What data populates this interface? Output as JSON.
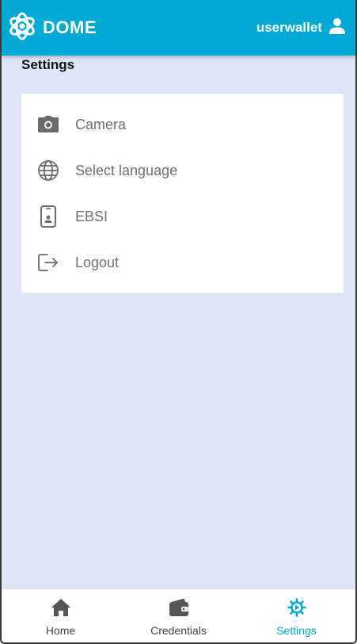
{
  "header": {
    "brand": "DOME",
    "username": "userwallet",
    "background": "#00a9d4"
  },
  "page": {
    "title": "Settings"
  },
  "settings_menu": [
    {
      "label": "Camera",
      "icon": "camera-icon"
    },
    {
      "label": "Select language",
      "icon": "globe-icon"
    },
    {
      "label": "EBSI",
      "icon": "id-phone-icon"
    },
    {
      "label": "Logout",
      "icon": "logout-icon"
    }
  ],
  "bottom_nav": [
    {
      "label": "Home",
      "icon": "home-icon",
      "active": false
    },
    {
      "label": "Credentials",
      "icon": "wallet-icon",
      "active": false
    },
    {
      "label": "Settings",
      "icon": "gear-icon",
      "active": true
    }
  ],
  "colors": {
    "accent": "#00a9d4",
    "page_background": "#dde5f6",
    "icon_gray": "#6b6b6b"
  }
}
